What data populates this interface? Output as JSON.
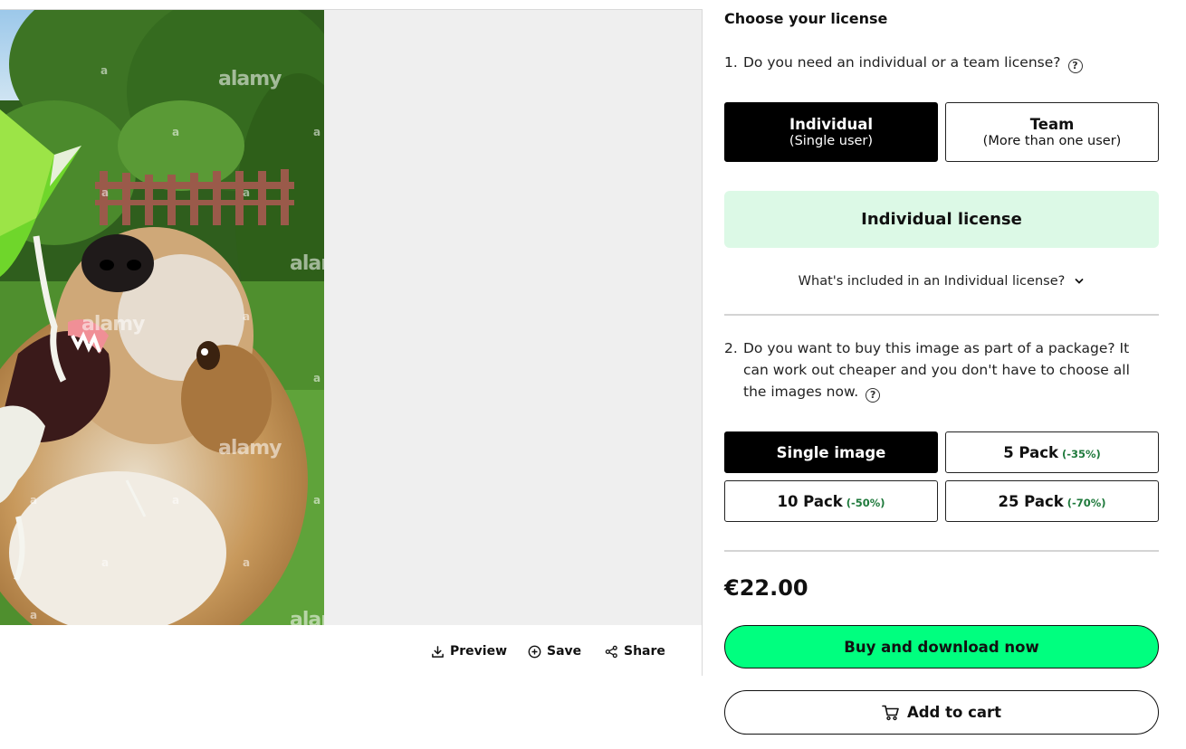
{
  "viewer": {
    "watermarks": [
      "alamy",
      "a"
    ],
    "toolbar": {
      "preview_label": "Preview",
      "save_label": "Save",
      "share_label": "Share"
    }
  },
  "license": {
    "heading": "Choose your license",
    "q1": {
      "number": "1.",
      "text": "Do you need an individual or a team license?",
      "help": "?"
    },
    "license_type_options": [
      {
        "title": "Individual",
        "subtitle": "(Single user)",
        "selected": true
      },
      {
        "title": "Team",
        "subtitle": "(More than one user)",
        "selected": false
      }
    ],
    "license_box_label": "Individual license",
    "included_link": "What's included in an Individual license?",
    "q2": {
      "number": "2.",
      "text": "Do you want to buy this image as part of a package? It can work out cheaper and you don't have to choose all the images now.",
      "help": "?"
    },
    "package_options": [
      {
        "title": "Single image",
        "discount": "",
        "selected": true
      },
      {
        "title": "5 Pack",
        "discount": "(-35%)",
        "selected": false
      },
      {
        "title": "10 Pack",
        "discount": "(-50%)",
        "selected": false
      },
      {
        "title": "25 Pack",
        "discount": "(-70%)",
        "selected": false
      }
    ],
    "price": "€22.00",
    "buy_label": "Buy and download now",
    "cart_label": "Add to cart"
  },
  "colors": {
    "buy_button": "#00ff7f",
    "license_box": "#dcf9e6",
    "selected_option": "#000000",
    "discount_text": "#1f7a3c"
  },
  "icons": [
    "download-icon",
    "plus-circle-icon",
    "share-icon",
    "help-icon",
    "chevron-down-icon",
    "cart-icon"
  ]
}
